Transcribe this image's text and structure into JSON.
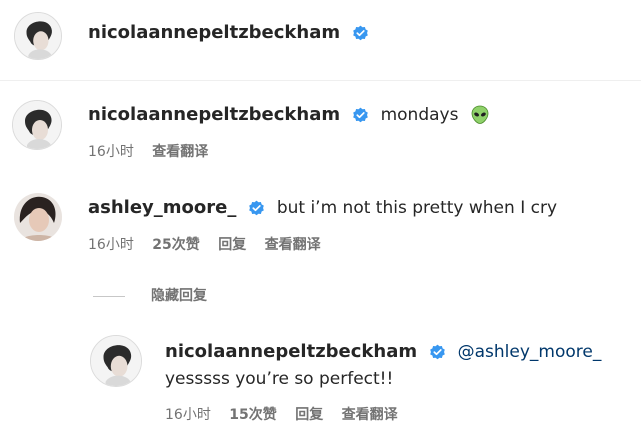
{
  "header": {
    "username": "nicolaannepeltzbeckham"
  },
  "caption": {
    "username": "nicolaannepeltzbeckham",
    "text": "mondays",
    "time": "16小时",
    "translate": "查看翻译"
  },
  "comment": {
    "username": "ashley_moore_",
    "text": "but i’m not this pretty when I cry",
    "time": "16小时",
    "likes": "25次赞",
    "reply": "回复",
    "translate": "查看翻译"
  },
  "hide_replies": "隐藏回复",
  "reply": {
    "username": "nicolaannepeltzbeckham",
    "mention": "@ashley_moore_",
    "text": "yesssss you’re so perfect!!",
    "time": "16小时",
    "likes": "15次赞",
    "reply": "回复",
    "translate": "查看翻译"
  },
  "colors": {
    "verified": "#3897f0",
    "mention": "#00376b",
    "meta": "#737373"
  }
}
